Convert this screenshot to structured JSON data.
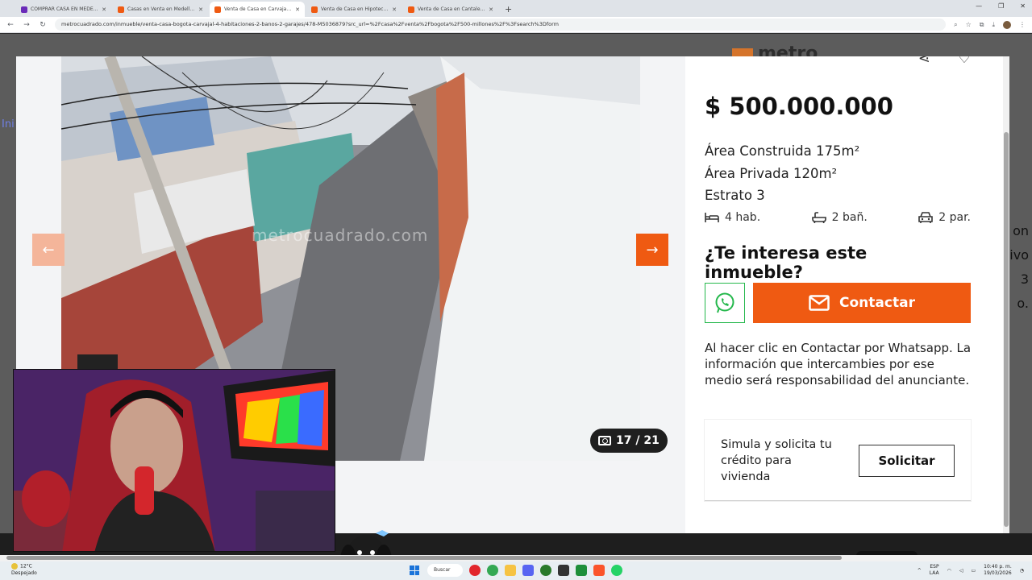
{
  "browser": {
    "tabs": [
      {
        "title": "COMPRAR CASA EN MEDELLIN",
        "color": "#6a2bb8",
        "active": false
      },
      {
        "title": "Casas en Venta en Medellin · V",
        "color": "#ef5a12",
        "active": false
      },
      {
        "title": "Venta de Casa en Carvajal - Bo",
        "color": "#ef5a12",
        "active": true
      },
      {
        "title": "Venta de Casa en Hipotecho · C",
        "color": "#ef5a12",
        "active": false
      },
      {
        "title": "Venta de Casa en Cantalejo · B",
        "color": "#ef5a12",
        "active": false
      }
    ],
    "new_tab_glyph": "+",
    "url": "metrocuadrado.com/inmueble/venta-casa-bogota-carvajal-4-habitaciones-2-banos-2-garajes/478-M5036879?src_url=%2Fcasa%2Fventa%2Fbogota%2F500-millones%2F%3Fsearch%3Dform"
  },
  "background_page": {
    "left_peek": "Ini",
    "right_peek": [
      "on",
      "ivo",
      "3",
      "o."
    ],
    "brand": "metro"
  },
  "gallery": {
    "watermark": "metrocuadrado.com",
    "counter": "17 / 21",
    "prev_glyph": "←",
    "next_glyph": "→"
  },
  "listing": {
    "price": "$ 500.000.000",
    "specs": [
      "Área Construida 175m²",
      "Área Privada 120m²",
      "Estrato 3"
    ],
    "features": {
      "rooms": "4 hab.",
      "baths": "2 bañ.",
      "parking": "2 par."
    },
    "interest_heading": "¿Te interesa este inmueble?",
    "contact_label": "Contactar",
    "note": "Al hacer clic en Contactar por Whatsapp. La información que intercambies por ese medio será responsabilidad del anunciante.",
    "credit_text": "Simula y solicita tu crédito para vivienda",
    "credit_button": "Solicitar"
  },
  "colors": {
    "accent": "#ef5a12",
    "whatsapp": "#25b84c"
  },
  "taskbar": {
    "weather_temp": "12°C",
    "weather_text": "Despejado",
    "search_label": "Buscar",
    "lang": "ESP",
    "lang2": "LAA",
    "time": "10:40 p. m.",
    "date": "19/03/2026"
  }
}
